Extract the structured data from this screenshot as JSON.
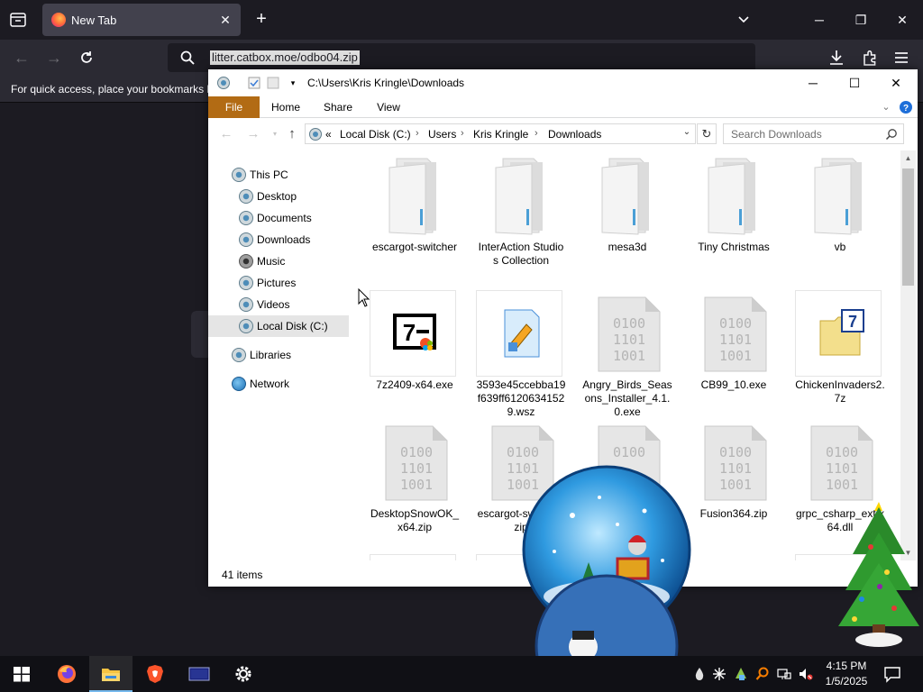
{
  "browser": {
    "tab_title": "New Tab",
    "url": "litter.catbox.moe/odbo04.zip",
    "bookmarks_hint": "For quick access, place your bookmarks h"
  },
  "explorer": {
    "title_path": "C:\\Users\\Kris Kringle\\Downloads",
    "ribbon_tabs": [
      "File",
      "Home",
      "Share",
      "View"
    ],
    "breadcrumb": [
      "Local Disk (C:)",
      "Users",
      "Kris Kringle",
      "Downloads"
    ],
    "breadcrumb_prefix": "«",
    "search_placeholder": "Search Downloads",
    "nav_items": [
      {
        "label": "This PC",
        "icon": "this-pc-icon"
      },
      {
        "label": "Desktop",
        "icon": "desktop-icon"
      },
      {
        "label": "Documents",
        "icon": "documents-icon"
      },
      {
        "label": "Downloads",
        "icon": "downloads-icon"
      },
      {
        "label": "Music",
        "icon": "music-icon"
      },
      {
        "label": "Pictures",
        "icon": "pictures-icon"
      },
      {
        "label": "Videos",
        "icon": "videos-icon"
      },
      {
        "label": "Local Disk (C:)",
        "icon": "local-disk-icon",
        "selected": true
      },
      {
        "label": "Libraries",
        "icon": "libraries-icon"
      },
      {
        "label": "Network",
        "icon": "network-icon"
      }
    ],
    "files": [
      {
        "name": "escargot-switcher",
        "kind": "folder"
      },
      {
        "name": "InterAction Studios Collection",
        "kind": "folder"
      },
      {
        "name": "mesa3d",
        "kind": "folder"
      },
      {
        "name": "Tiny Christmas",
        "kind": "folder"
      },
      {
        "name": "vb",
        "kind": "folder"
      },
      {
        "name": "7z2409-x64.exe",
        "kind": "7zip"
      },
      {
        "name": "3593e45ccebba19f639ff61206341529.wsz",
        "kind": "wsz"
      },
      {
        "name": "Angry_Birds_Seasons_Installer_4.1.0.exe",
        "kind": "binary"
      },
      {
        "name": "CB99_10.exe",
        "kind": "binary"
      },
      {
        "name": "ChickenInvaders2.7z",
        "kind": "7z-archive"
      },
      {
        "name": "DesktopSnowOK_x64.zip",
        "kind": "binary"
      },
      {
        "name": "escargot-switcher.zip",
        "kind": "binary"
      },
      {
        "name": "",
        "kind": "binary"
      },
      {
        "name": "Fusion364.zip",
        "kind": "binary"
      },
      {
        "name": "grpc_csharp_ext.x64.dll",
        "kind": "binary"
      }
    ],
    "status": "41 items"
  },
  "taskbar": {
    "time": "4:15 PM",
    "date": "1/5/2025",
    "apps": [
      "firefox",
      "file-explorer",
      "brave",
      "display",
      "settings"
    ]
  },
  "colors": {
    "ff_bg": "#1c1b22",
    "ff_toolbar": "#2b2a33",
    "file_tab": "#b26b14",
    "taskbar": "#101015"
  }
}
